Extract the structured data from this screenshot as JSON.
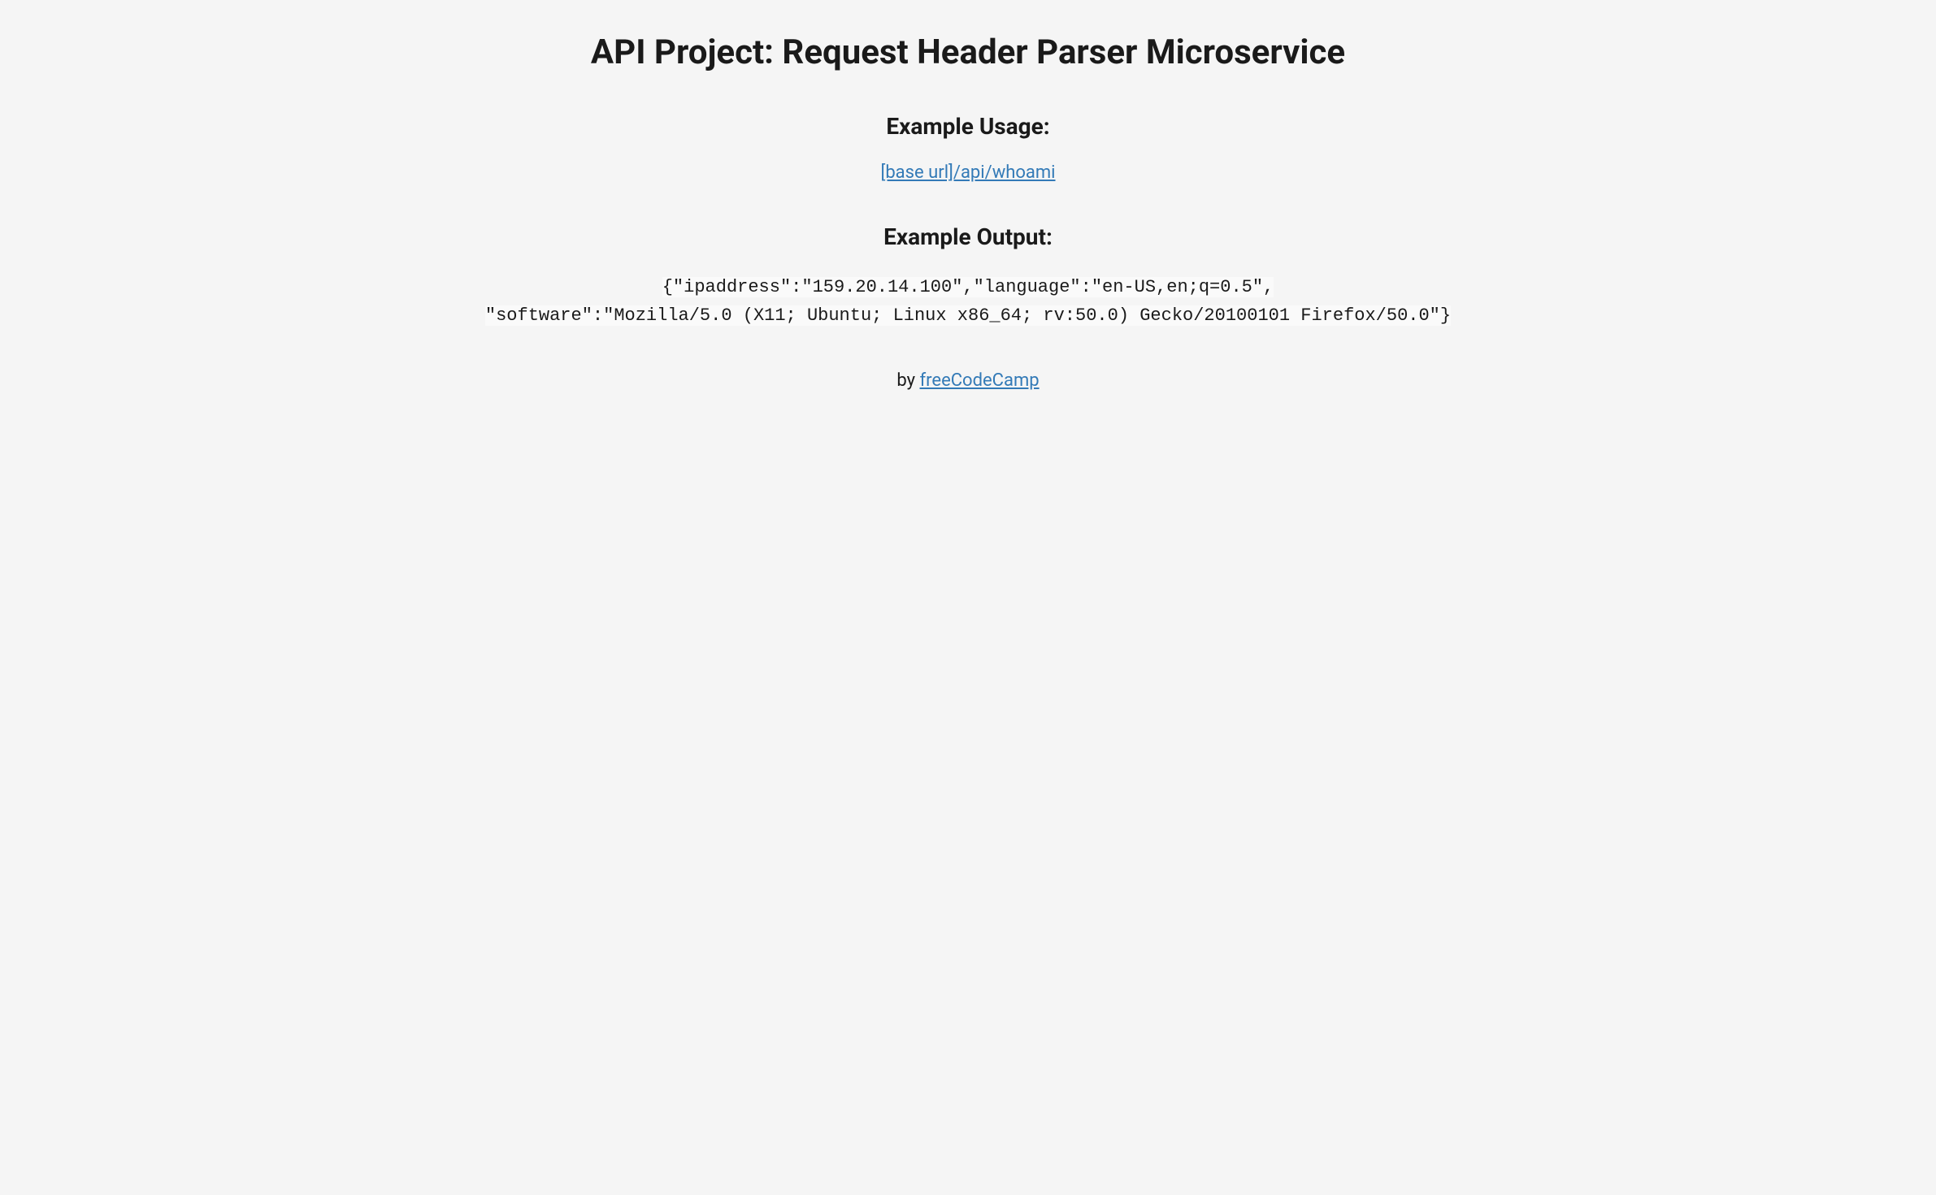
{
  "title": "API Project: Request Header Parser Microservice",
  "usage": {
    "heading": "Example Usage:",
    "link_text": "[base url]/api/whoami"
  },
  "output": {
    "heading": "Example Output:",
    "line1": "{\"ipaddress\":\"159.20.14.100\",\"language\":\"en-US,en;q=0.5\",",
    "line2": "\"software\":\"Mozilla/5.0 (X11; Ubuntu; Linux x86_64; rv:50.0) Gecko/20100101 Firefox/50.0\"}"
  },
  "footer": {
    "by_text": "by ",
    "link_text": "freeCodeCamp"
  }
}
